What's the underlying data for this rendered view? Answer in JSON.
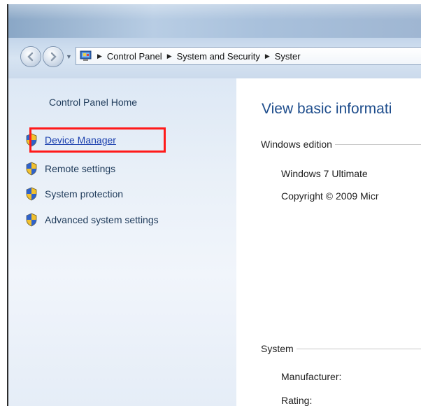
{
  "breadcrumb": {
    "items": [
      "Control Panel",
      "System and Security",
      "Syster"
    ]
  },
  "sidebar": {
    "home_label": "Control Panel Home",
    "tasks": [
      {
        "label": "Device Manager",
        "icon": "uac-shield-icon"
      },
      {
        "label": "Remote settings",
        "icon": "uac-shield-icon"
      },
      {
        "label": "System protection",
        "icon": "uac-shield-icon"
      },
      {
        "label": "Advanced system settings",
        "icon": "uac-shield-icon"
      }
    ]
  },
  "main": {
    "heading": "View basic informati",
    "windows_edition": {
      "section_label": "Windows edition",
      "edition": "Windows 7 Ultimate",
      "copyright": "Copyright © 2009 Micr"
    },
    "system": {
      "section_label": "System",
      "manufacturer_label": "Manufacturer:",
      "rating_label": "Rating:"
    }
  },
  "colors": {
    "highlight_border": "#ff1a1a",
    "link": "#1a3fae",
    "heading": "#1e4d8c"
  }
}
